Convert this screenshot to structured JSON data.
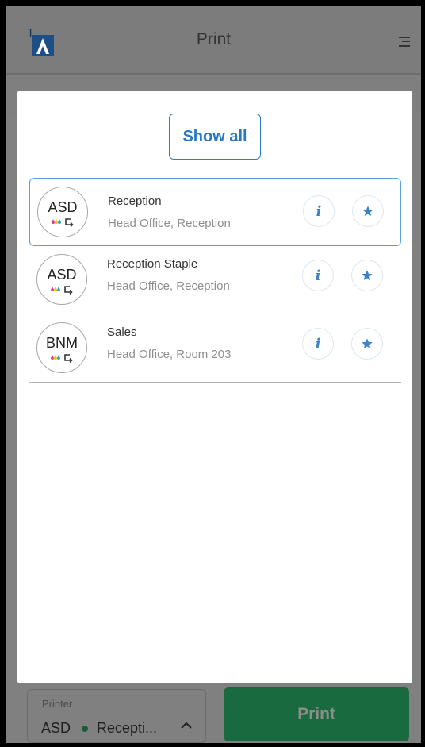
{
  "header": {
    "title": "Print",
    "logo_text": "TA"
  },
  "modal": {
    "show_all_label": "Show all",
    "printers": [
      {
        "code": "ASD",
        "name": "Reception",
        "location": "Head Office, Reception",
        "selected": true
      },
      {
        "code": "ASD",
        "name": "Reception Staple",
        "location": "Head Office, Reception",
        "selected": false
      },
      {
        "code": "BNM",
        "name": "Sales",
        "location": "Head Office, Room 203",
        "selected": false
      }
    ]
  },
  "bottom_bar": {
    "printer_label": "Printer",
    "printer_code": "ASD",
    "printer_name": "Recepti...",
    "print_label": "Print"
  },
  "colors": {
    "accent": "#2a78c5",
    "print_button": "#1a6a3f",
    "status_online": "#1c5c36"
  },
  "icons": [
    "ta-logo-icon",
    "hamburger-menu-icon",
    "color-ink-icon",
    "duplex-icon",
    "info-icon",
    "star-icon",
    "chevron-up-icon"
  ]
}
